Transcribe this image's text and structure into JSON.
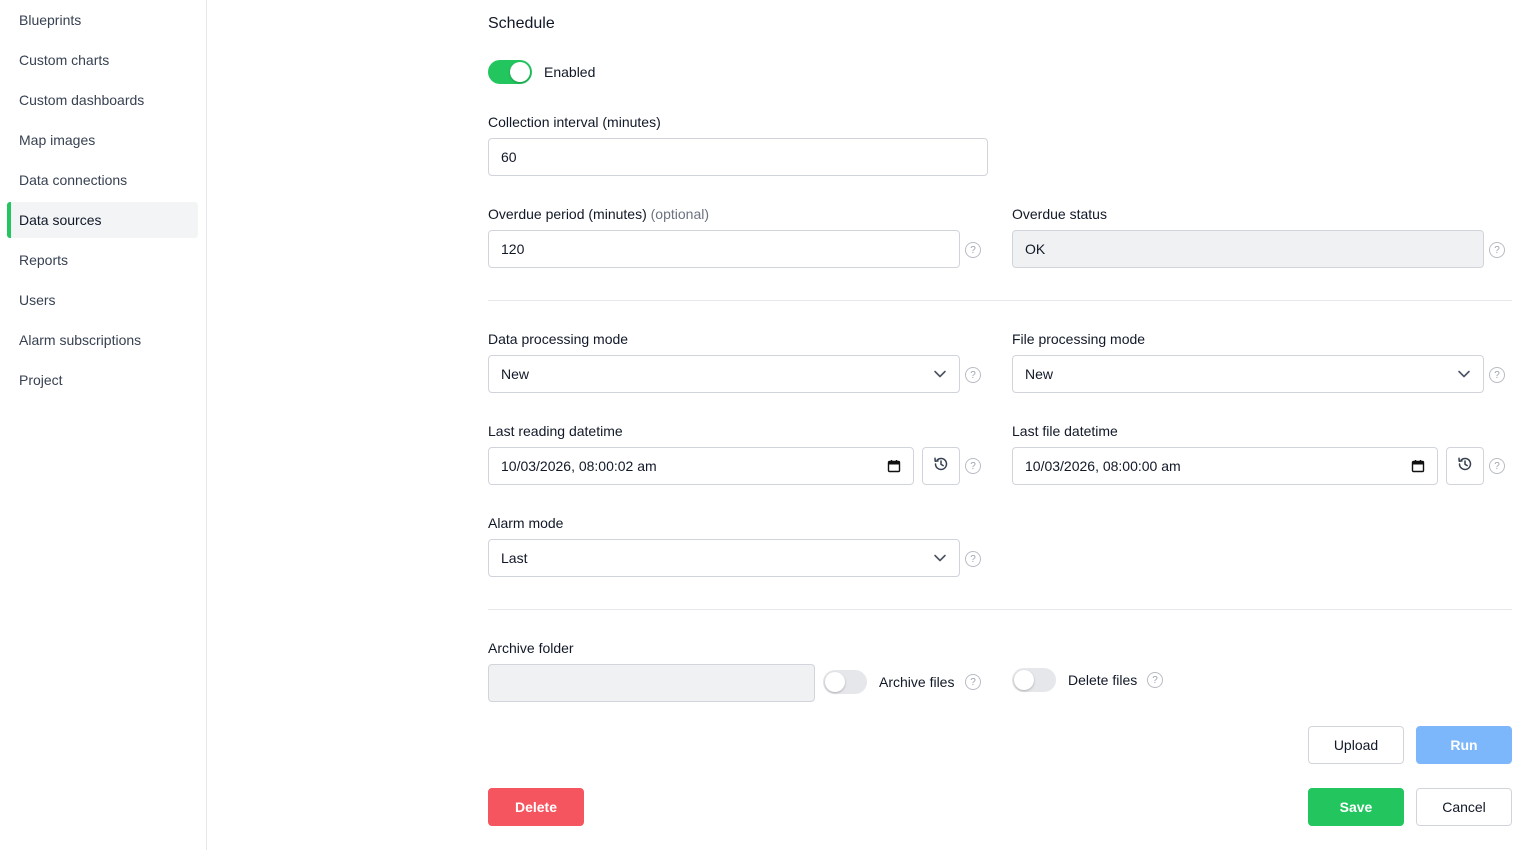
{
  "sidebar": {
    "items": [
      {
        "label": "Blueprints"
      },
      {
        "label": "Custom charts"
      },
      {
        "label": "Custom dashboards"
      },
      {
        "label": "Map images"
      },
      {
        "label": "Data connections"
      },
      {
        "label": "Data sources",
        "active": true
      },
      {
        "label": "Reports"
      },
      {
        "label": "Users"
      },
      {
        "label": "Alarm subscriptions"
      },
      {
        "label": "Project"
      }
    ]
  },
  "schedule": {
    "title": "Schedule",
    "enabled_label": "Enabled",
    "enabled": true
  },
  "collection_interval": {
    "label": "Collection interval (minutes)",
    "value": "60"
  },
  "overdue_period": {
    "label": "Overdue period (minutes)",
    "optional": "(optional)",
    "value": "120"
  },
  "overdue_status": {
    "label": "Overdue status",
    "value": "OK"
  },
  "data_processing_mode": {
    "label": "Data processing mode",
    "value": "New"
  },
  "file_processing_mode": {
    "label": "File processing mode",
    "value": "New"
  },
  "last_reading_datetime": {
    "label": "Last reading datetime",
    "value": "10/03/2026, 08:00:02 am"
  },
  "last_file_datetime": {
    "label": "Last file datetime",
    "value": "10/03/2026, 08:00:00 am"
  },
  "alarm_mode": {
    "label": "Alarm mode",
    "value": "Last"
  },
  "archive": {
    "folder_label": "Archive folder",
    "folder_value": "",
    "archive_files_label": "Archive files",
    "archive_files": false,
    "delete_files_label": "Delete files",
    "delete_files": false
  },
  "help_glyph": "?",
  "actions": {
    "upload": "Upload",
    "run": "Run",
    "delete": "Delete",
    "save": "Save",
    "cancel": "Cancel"
  },
  "colors": {
    "accent": "#22c55e",
    "danger": "#f4555f",
    "primary_disabled": "#7cb7fb"
  }
}
